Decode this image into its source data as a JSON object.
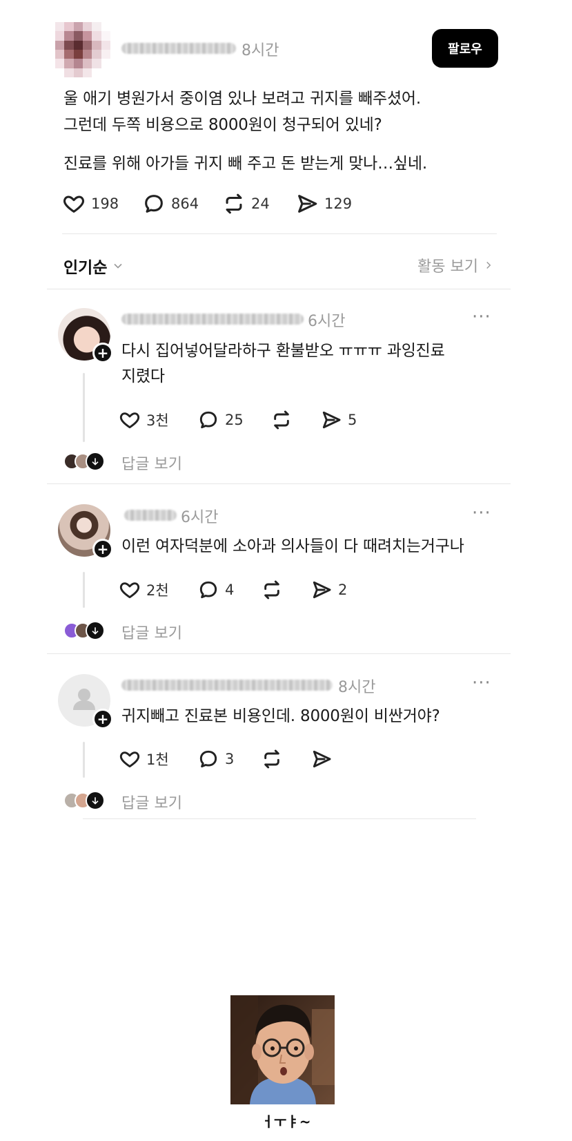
{
  "post": {
    "time": "8시간",
    "follow_label": "팔로우",
    "lines": [
      "울 애기 병원가서 중이염 있나 보려고 귀지를 빼주셨어.",
      "그런데 두쪽 비용으로 8000원이 청구되어 있네?",
      "진료를 위해 아가들 귀지 빼 주고 돈 받는게 맞나…싶네."
    ],
    "likes": "198",
    "comments": "864",
    "reposts": "24",
    "shares": "129"
  },
  "sort": {
    "label": "인기순",
    "activity_label": "활동 보기"
  },
  "replies": [
    {
      "time": "6시간",
      "line1": "다시 집어넣어달라하구 환불받오 ㅠㅠㅠ 과잉진료",
      "line2": "지렸다",
      "likes": "3천",
      "comments": "25",
      "reposts": "",
      "shares": "5",
      "view_replies": "답글 보기"
    },
    {
      "time": "6시간",
      "line1": "이런 여자덕분에 소아과 의사들이 다 때려치는거구나",
      "likes": "2천",
      "comments": "4",
      "reposts": "",
      "shares": "2",
      "view_replies": "답글 보기"
    },
    {
      "time": "8시간",
      "line1": "귀지빼고 진료본 비용인데. 8000원이 비싼거야?",
      "likes": "1천",
      "comments": "3",
      "reposts": "",
      "shares": "",
      "view_replies": "답글 보기"
    }
  ],
  "meme": {
    "caption": "ㅓㅜㅑ~"
  },
  "colors": {
    "accent": "#000000",
    "muted": "#9a9a9a",
    "divider": "#e6e6e6"
  }
}
